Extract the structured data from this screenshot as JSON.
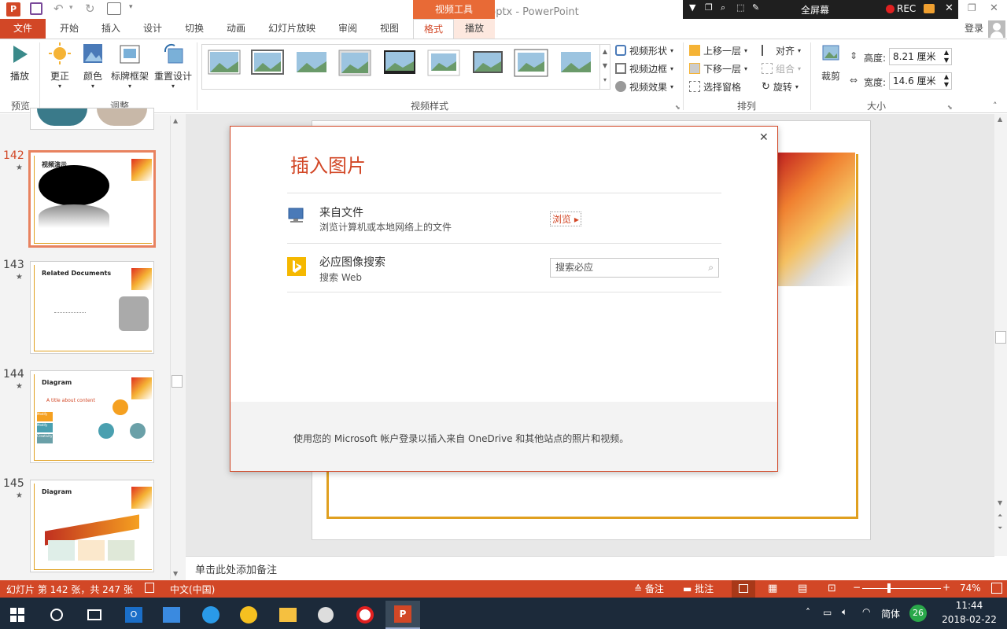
{
  "window": {
    "title": "ppt模板大成.pptx - PowerPoint",
    "context_tool": "视频工具",
    "sign_in": "登录"
  },
  "recorder": {
    "fullscreen": "全屏幕",
    "rec": "REC"
  },
  "tabs": [
    "文件",
    "开始",
    "插入",
    "设计",
    "切换",
    "动画",
    "幻灯片放映",
    "审阅",
    "视图",
    "格式",
    "播放"
  ],
  "ribbon": {
    "preview": {
      "play": "播放",
      "label": "预览"
    },
    "adjust": {
      "correct": "更正",
      "color": "颜色",
      "poster_frame": "标牌框架",
      "reset": "重置设计",
      "label": "调整"
    },
    "video_styles": {
      "label": "视频样式",
      "shape": "视频形状",
      "border": "视频边框",
      "effects": "视频效果"
    },
    "arrange": {
      "forward": "上移一层",
      "backward": "下移一层",
      "selection_pane": "选择窗格",
      "align": "对齐",
      "group": "组合",
      "rotate": "旋转",
      "label": "排列"
    },
    "size": {
      "crop": "裁剪",
      "height_label": "高度:",
      "height_value": "8.21 厘米",
      "width_label": "宽度:",
      "width_value": "14.6 厘米",
      "label": "大小"
    }
  },
  "thumbs": [
    {
      "num": "142",
      "title": "视频演示",
      "selected": true
    },
    {
      "num": "143",
      "title": "Related Documents",
      "selected": false
    },
    {
      "num": "144",
      "title": "Diagram",
      "selected": false
    },
    {
      "num": "145",
      "title": "Diagram",
      "selected": false
    }
  ],
  "thumb144": {
    "subtitle": "A title about content",
    "items": [
      "Modify",
      "Modify",
      "Creativity"
    ]
  },
  "notes_placeholder": "单击此处添加备注",
  "dialog": {
    "title": "插入图片",
    "from_file": {
      "heading": "来自文件",
      "desc": "浏览计算机或本地网络上的文件",
      "link": "浏览 ▸"
    },
    "bing": {
      "heading": "必应图像搜索",
      "desc": "搜索 Web",
      "placeholder": "搜索必应"
    },
    "footer": "使用您的 Microsoft 帐户登录以插入来自 OneDrive 和其他站点的照片和视频。"
  },
  "status": {
    "slide_info": "幻灯片 第 142 张，共 247 张",
    "language": "中文(中国)",
    "notes": "备注",
    "comments": "批注",
    "zoom": "74%"
  },
  "taskbar": {
    "time": "11:44",
    "date": "2018-02-22",
    "ime": "简体",
    "badge": "26"
  },
  "colors": {
    "accent": "#d24726",
    "accent_tab": "#e86a36",
    "taskbar": "#1c2a3a"
  }
}
